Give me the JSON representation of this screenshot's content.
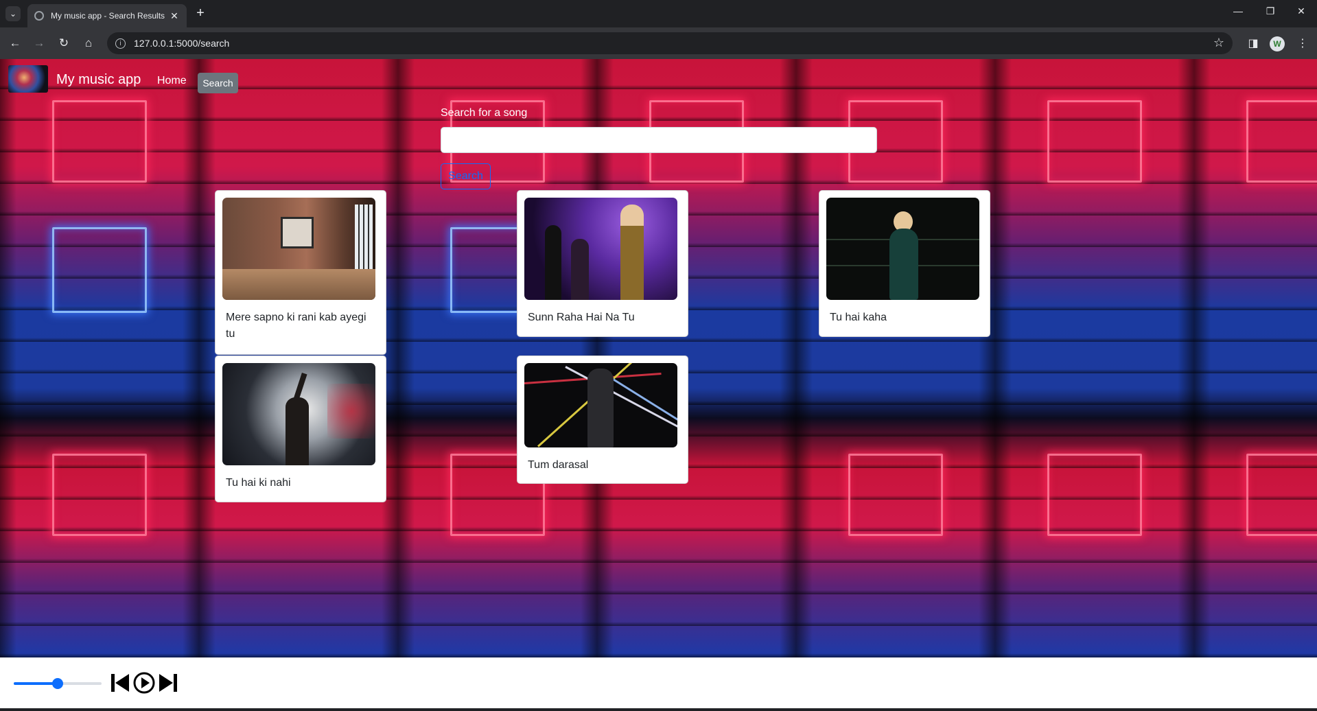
{
  "browser": {
    "tab_title": "My music app - Search Results",
    "url": "127.0.0.1:5000/search",
    "profile_initial": "W"
  },
  "navbar": {
    "brand": "My music app",
    "links": {
      "home": "Home",
      "search": "Search"
    }
  },
  "search": {
    "label": "Search for a song",
    "input_value": "",
    "button_label": "Search"
  },
  "results": [
    {
      "title": "Mere sapno ki rani kab ayegi tu"
    },
    {
      "title": "Sunn Raha Hai Na Tu"
    },
    {
      "title": "Tu hai kaha"
    },
    {
      "title": "Tu hai ki nahi"
    },
    {
      "title": "Tum darasal"
    }
  ],
  "player": {
    "volume": 0.5
  },
  "colors": {
    "accent": "#0d6efd",
    "nav_active": "#6c757d"
  }
}
